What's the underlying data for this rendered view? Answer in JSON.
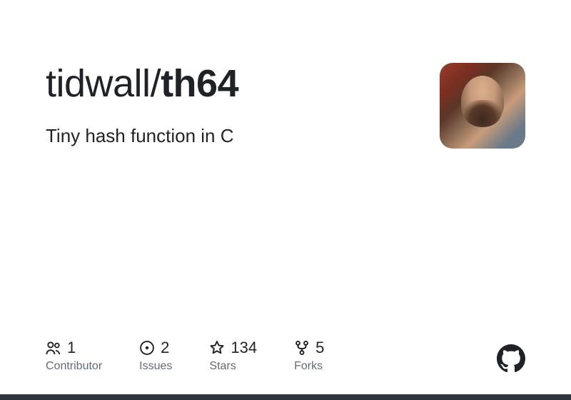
{
  "repo": {
    "owner": "tidwall",
    "name": "th64",
    "description": "Tiny hash function in C"
  },
  "stats": [
    {
      "icon": "people-icon",
      "count": "1",
      "label": "Contributor"
    },
    {
      "icon": "issue-icon",
      "count": "2",
      "label": "Issues"
    },
    {
      "icon": "star-icon",
      "count": "134",
      "label": "Stars"
    },
    {
      "icon": "fork-icon",
      "count": "5",
      "label": "Forks"
    }
  ]
}
